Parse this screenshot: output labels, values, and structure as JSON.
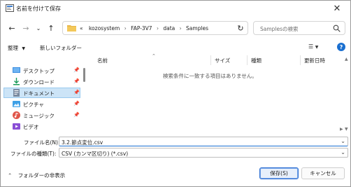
{
  "title": "名前を付けて保存",
  "nav": {
    "breadcrumbs": [
      "kozosystem",
      "FAP-3V7",
      "data",
      "Samples"
    ],
    "search_placeholder": "Samplesの検索"
  },
  "toolbar": {
    "organize": "整理",
    "new_folder": "新しいフォルダー"
  },
  "sidebar": {
    "items": [
      {
        "label": "デスクトップ",
        "icon": "desktop-icon"
      },
      {
        "label": "ダウンロード",
        "icon": "download-icon"
      },
      {
        "label": "ドキュメント",
        "icon": "documents-icon"
      },
      {
        "label": "ピクチャ",
        "icon": "pictures-icon"
      },
      {
        "label": "ミュージック",
        "icon": "music-icon"
      },
      {
        "label": "ビデオ",
        "icon": "video-icon"
      }
    ],
    "selected_index": 2
  },
  "columns": [
    "名前",
    "サイズ",
    "種類",
    "更新日時"
  ],
  "empty_message": "検索条件に一致する項目はありません。",
  "form": {
    "filename_label": "ファイル名(N):",
    "filename_value": "3.2.節点変位.csv",
    "filetype_label": "ファイルの種類(T):",
    "filetype_value": "CSV (カンマ区切り) (*.csv)"
  },
  "footer": {
    "hide_folders": "フォルダーの非表示",
    "save": "保存(S)",
    "cancel": "キャンセル"
  },
  "colors": {
    "accent": "#1a6fd0",
    "selection": "#cce4f7",
    "folder": "#e8b84a"
  }
}
